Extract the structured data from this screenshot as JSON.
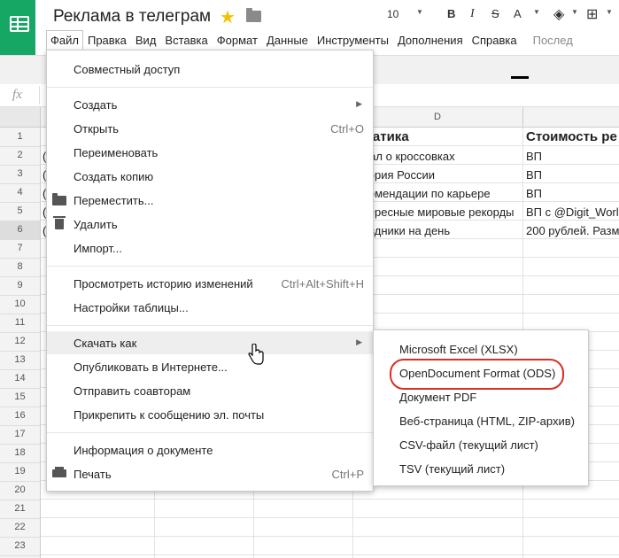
{
  "header": {
    "title": "Реклама в телеграм",
    "star_icon": "star-icon",
    "folder_icon": "folder-icon"
  },
  "menubar": {
    "items": [
      "Файл",
      "Правка",
      "Вид",
      "Вставка",
      "Формат",
      "Данные",
      "Инструменты",
      "Дополнения",
      "Справка"
    ],
    "hint": "Послед"
  },
  "toolbar": {
    "font_size": "10",
    "bold": "B",
    "italic": "I",
    "strike": "S",
    "text_color": "A"
  },
  "formula": {
    "fx": "fx"
  },
  "grid": {
    "col_d": "D",
    "rows": [
      "1",
      "2",
      "3",
      "4",
      "5",
      "6",
      "7",
      "8",
      "9",
      "10",
      "11",
      "12",
      "13",
      "14",
      "15",
      "16",
      "17",
      "18",
      "19",
      "20",
      "21",
      "22",
      "23"
    ],
    "cells_d": [
      "матика",
      "нал о кроссовках",
      "тория России",
      "комендации по карьере",
      "тересные мировые рекорды",
      "аздники на день"
    ],
    "cells_e": [
      "Стоимость ре",
      "ВП",
      "ВП",
      "ВП",
      "ВП с @Digit_Worl",
      "200 рублей. Разм"
    ],
    "cells_a": [
      "",
      "(",
      "(",
      "(",
      "(",
      "("
    ]
  },
  "file_menu": {
    "share": "Совместный доступ",
    "create": "Создать",
    "open": "Открыть",
    "open_shortcut": "Ctrl+O",
    "rename": "Переименовать",
    "copy": "Создать копию",
    "move": "Переместить...",
    "delete": "Удалить",
    "import": "Импорт...",
    "history": "Просмотреть историю изменений",
    "history_shortcut": "Ctrl+Alt+Shift+H",
    "settings": "Настройки таблицы...",
    "download": "Скачать как",
    "publish": "Опубликовать в Интернете...",
    "send": "Отправить соавторам",
    "email": "Прикрепить к сообщению эл. почты",
    "info": "Информация о документе",
    "print": "Печать",
    "print_shortcut": "Ctrl+P"
  },
  "download_submenu": {
    "items": [
      "Microsoft Excel (XLSX)",
      "OpenDocument Format (ODS)",
      "Документ PDF",
      "Веб-страница (HTML, ZIP-архив)",
      "CSV-файл (текущий лист)",
      "TSV (текущий лист)"
    ],
    "highlight_color": "#d93025"
  },
  "colors": {
    "brand": "#16a765",
    "toolbar_bg": "#f1f1f1"
  }
}
